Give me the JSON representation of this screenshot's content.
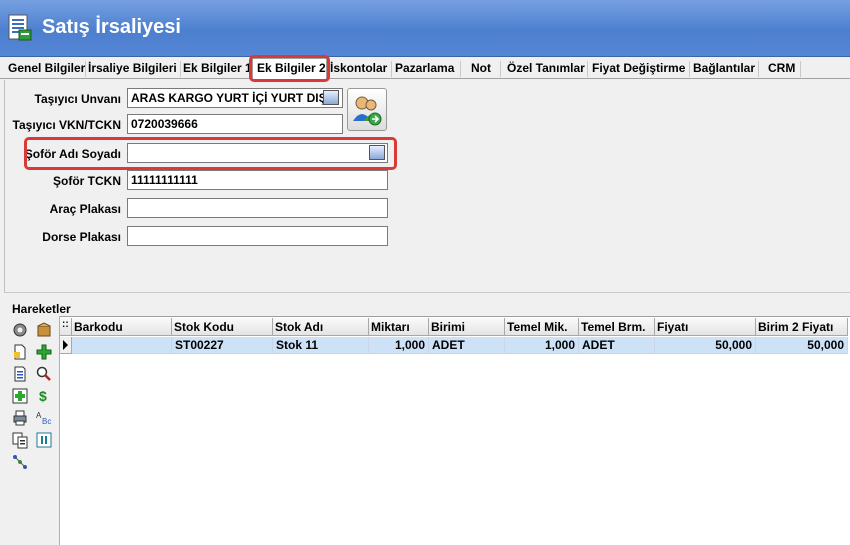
{
  "window": {
    "title": "Satış İrsaliyesi",
    "app_icon": "document-form-icon"
  },
  "tabs": [
    {
      "label": "Genel Bilgiler",
      "active": false
    },
    {
      "label": "İrsaliye Bilgileri",
      "active": false
    },
    {
      "label": "Ek Bilgiler 1",
      "active": false
    },
    {
      "label": "Ek Bilgiler 2",
      "active": true
    },
    {
      "label": "İskontolar",
      "active": false
    },
    {
      "label": "Pazarlama",
      "active": false
    },
    {
      "label": "Not",
      "active": false
    },
    {
      "label": "Özel Tanımlar",
      "active": false
    },
    {
      "label": "Fiyat Değiştirme",
      "active": false
    },
    {
      "label": "Bağlantılar",
      "active": false
    },
    {
      "label": "CRM",
      "active": false
    }
  ],
  "form": {
    "carrier_title_label": "Taşıyıcı Unvanı",
    "carrier_title_value": "ARAS KARGO YURT İÇİ YURT DIŞI",
    "carrier_tax_label": "Taşıyıcı VKN/TCKN",
    "carrier_tax_value": "0720039666",
    "driver_name_label": "Şoför Adı Soyadı",
    "driver_name_value": "",
    "driver_id_label": "Şoför TCKN",
    "driver_id_value": "11111111111",
    "vehicle_plate_label": "Araç Plakası",
    "vehicle_plate_value": "",
    "trailer_plate_label": "Dorse Plakası",
    "trailer_plate_value": ""
  },
  "movements": {
    "section_title": "Hareketler",
    "columns": [
      "Barkodu",
      "Stok Kodu",
      "Stok Adı",
      "Miktarı",
      "Birimi",
      "Temel Mik.",
      "Temel Brm.",
      "Fiyatı",
      "Birim 2 Fiyatı"
    ],
    "rows": [
      {
        "barkodu": "",
        "stok_kodu": "ST00227",
        "stok_adi": "Stok 11",
        "miktari": "1,000",
        "birimi": "ADET",
        "temel_mik": "1,000",
        "temel_brm": "ADET",
        "fiyati": "50,000",
        "birim2_fiyati": "50,000"
      }
    ],
    "toolbar_icons": [
      "gear-icon",
      "package-icon",
      "new-document-icon",
      "add-icon",
      "document-list-icon",
      "search-icon",
      "add-row-icon",
      "currency-icon",
      "print-icon",
      "text-options-icon",
      "copy-icon",
      "split-icon",
      "connect-icon"
    ]
  },
  "colors": {
    "titlebar": "#5586d4",
    "highlight_box": "#d83a3a",
    "selected_row": "#cde1f7"
  }
}
